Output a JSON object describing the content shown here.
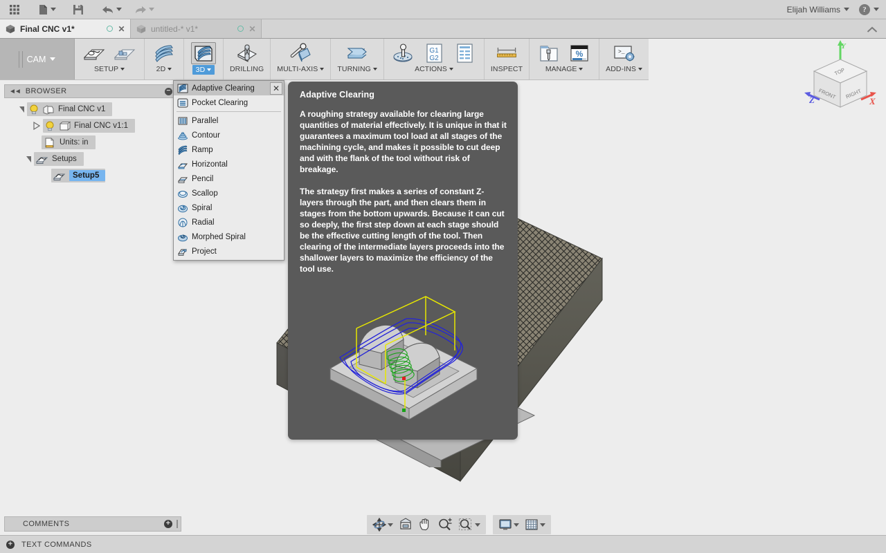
{
  "app": {
    "user_name": "Elijah Williams",
    "help_icon": "help-question-icon",
    "grid_icon": "app-grid-icon",
    "new_icon": "new-document-icon",
    "save_icon": "save-icon",
    "undo_icon": "undo-arrow-icon",
    "redo_icon": "redo-arrow-icon"
  },
  "tabs": [
    {
      "title": "Final CNC v1*",
      "state": "active",
      "cube_icon": "document-cube-icon",
      "dot_icon": "sync-circle-icon",
      "close_icon": "close-x-icon"
    },
    {
      "title": "untitled-* v1*",
      "state": "inactive",
      "cube_icon": "document-cube-icon",
      "dot_icon": "sync-circle-icon",
      "close_icon": "close-x-icon"
    }
  ],
  "tabbar": {
    "collapse_icon": "chevron-up-icon"
  },
  "workspace": {
    "label": "CAM",
    "caret": "▾"
  },
  "ribbon": {
    "groups": [
      {
        "name": "setup",
        "items": [
          {
            "label": "",
            "icon": "setup-new-icon"
          },
          {
            "label": "",
            "icon": "setup-sheet-icon"
          }
        ],
        "group_label": "SETUP",
        "has_caret": true
      },
      {
        "name": "2d",
        "items": [
          {
            "label": "",
            "icon": "toolpath-2d-icon"
          }
        ],
        "group_label": "2D",
        "has_caret": true
      },
      {
        "name": "3d",
        "items": [
          {
            "label": "",
            "icon": "toolpath-3d-icon"
          }
        ],
        "group_label": "3D",
        "has_caret": true,
        "selected": true
      },
      {
        "name": "drilling",
        "items": [
          {
            "label": "",
            "icon": "drilling-icon"
          }
        ],
        "group_label": "DRILLING",
        "has_caret": false
      },
      {
        "name": "multi-axis",
        "items": [
          {
            "label": "",
            "icon": "multi-axis-icon"
          }
        ],
        "group_label": "MULTI-AXIS",
        "has_caret": true
      },
      {
        "name": "turning",
        "items": [
          {
            "label": "",
            "icon": "turning-icon"
          }
        ],
        "group_label": "TURNING",
        "has_caret": true
      },
      {
        "name": "actions",
        "items": [
          {
            "label": "",
            "icon": "simulate-icon"
          },
          {
            "label": "",
            "icon": "post-process-g1g2-icon"
          },
          {
            "label": "",
            "icon": "setup-sheet-list-icon"
          }
        ],
        "group_label": "ACTIONS",
        "has_caret": true
      },
      {
        "name": "inspect",
        "items": [
          {
            "label": "",
            "icon": "measure-ruler-icon"
          }
        ],
        "group_label": "INSPECT",
        "has_caret": false
      },
      {
        "name": "manage",
        "items": [
          {
            "label": "",
            "icon": "tool-library-icon"
          },
          {
            "label": "",
            "icon": "machining-time-percent-icon"
          }
        ],
        "group_label": "MANAGE",
        "has_caret": true
      },
      {
        "name": "add-ins",
        "items": [
          {
            "label": "",
            "icon": "scripts-addins-icon"
          }
        ],
        "group_label": "ADD-INS",
        "has_caret": true
      }
    ],
    "labels": {
      "g1": "G1",
      "g2": "G2",
      "percent": "%"
    }
  },
  "browser": {
    "title": "BROWSER",
    "collapse_icon": "double-chevron-left-icon",
    "minimize_icon": "minus-circle-icon",
    "tree": [
      {
        "label": "Final CNC v1",
        "indent": 0,
        "expander": "open",
        "bulb": true,
        "icon": "component-icon",
        "selected": false
      },
      {
        "label": "Final CNC v1:1",
        "indent": 1,
        "expander": "closed",
        "bulb": true,
        "icon": "body-cube-icon",
        "selected": false
      },
      {
        "label": "Units: in",
        "indent": 1,
        "expander": "none",
        "bulb": false,
        "icon": "units-doc-icon",
        "selected": false
      },
      {
        "label": "Setups",
        "indent": 0,
        "expander": "open",
        "bulb": false,
        "icon": "setup-folder-icon",
        "selected": false
      },
      {
        "label": "Setup5",
        "indent": 2,
        "expander": "none",
        "bulb": false,
        "icon": "setup-folder-icon",
        "selected": true
      }
    ]
  },
  "dropdown": {
    "close_icon": "close-x-icon",
    "items": [
      {
        "label": "Adaptive Clearing",
        "icon": "adaptive-clearing-icon",
        "highlighted": true,
        "separator_after": false
      },
      {
        "label": "Pocket Clearing",
        "icon": "pocket-clearing-icon",
        "highlighted": false,
        "separator_after": true
      },
      {
        "label": "Parallel",
        "icon": "parallel-icon",
        "highlighted": false,
        "separator_after": false
      },
      {
        "label": "Contour",
        "icon": "contour-icon",
        "highlighted": false,
        "separator_after": false
      },
      {
        "label": "Ramp",
        "icon": "ramp-icon",
        "highlighted": false,
        "separator_after": false
      },
      {
        "label": "Horizontal",
        "icon": "horizontal-icon",
        "highlighted": false,
        "separator_after": false
      },
      {
        "label": "Pencil",
        "icon": "pencil-icon",
        "highlighted": false,
        "separator_after": false
      },
      {
        "label": "Scallop",
        "icon": "scallop-icon",
        "highlighted": false,
        "separator_after": false
      },
      {
        "label": "Spiral",
        "icon": "spiral-icon",
        "highlighted": false,
        "separator_after": false
      },
      {
        "label": "Radial",
        "icon": "radial-icon",
        "highlighted": false,
        "separator_after": false
      },
      {
        "label": "Morphed Spiral",
        "icon": "morphed-spiral-icon",
        "highlighted": false,
        "separator_after": false
      },
      {
        "label": "Project",
        "icon": "project-icon",
        "highlighted": false,
        "separator_after": false
      }
    ]
  },
  "tooltip": {
    "title": "Adaptive Clearing",
    "paragraph1": "A roughing strategy available for clearing large quantities of material effectively. It is unique in that it guarantees a maximum tool load at all stages of the machining cycle, and makes it possible to cut deep and with the flank of the tool without risk of breakage.",
    "paragraph2": "The strategy first makes a series of constant Z-layers through the part, and then clears them in stages from the bottom upwards. Because it can cut so deeply, the first step down at each stage should be the effective cutting length of the tool. Then clearing of the intermediate layers proceeds into the shallower layers to maximize the efficiency of the tool use.",
    "figure_icon": "adaptive-clearing-preview"
  },
  "viewcube": {
    "face_top": "TOP",
    "face_front": "FRONT",
    "face_right": "RIGHT",
    "axis_x": "X",
    "axis_y": "Y",
    "axis_z": "Z",
    "color_x": "#e8534a",
    "color_y": "#63d663",
    "color_z": "#5b5be0"
  },
  "bottom": {
    "comments_label": "COMMENTS",
    "comments_add_icon": "plus-circle-icon",
    "text_commands_label": "TEXT COMMANDS",
    "text_commands_icon": "plus-circle-icon",
    "nav_buttons": [
      {
        "name": "orbit",
        "icon": "orbit-icon",
        "caret": true
      },
      {
        "name": "look-at",
        "icon": "look-at-icon",
        "caret": false
      },
      {
        "name": "pan",
        "icon": "pan-hand-icon",
        "caret": false
      },
      {
        "name": "zoom",
        "icon": "zoom-plus-minus-icon",
        "caret": false
      },
      {
        "name": "fit",
        "icon": "zoom-window-icon",
        "caret": true
      }
    ],
    "display_buttons": [
      {
        "name": "display-settings",
        "icon": "monitor-icon",
        "caret": true
      },
      {
        "name": "grid-snaps",
        "icon": "grid-icon",
        "caret": true
      }
    ]
  },
  "colors": {
    "accent_blue": "#4f9bd9",
    "selection_blue": "#77b5ef",
    "toolpath_blue": "#2020d0",
    "toolpath_green": "#19a319",
    "toolpath_yellow": "#e8e800",
    "tooltip_bg": "#5a5a5a",
    "viewport_bg": "#ededed",
    "chrome_bg": "#d4d4d4"
  }
}
